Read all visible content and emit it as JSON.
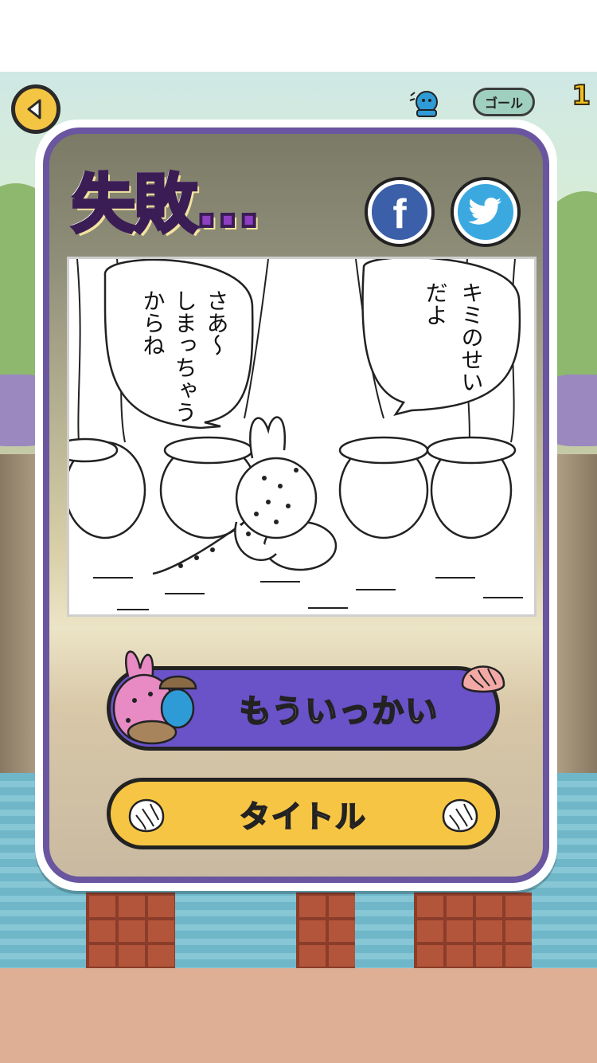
{
  "hud": {
    "goal_label": "ゴール",
    "score": "1"
  },
  "result": {
    "title": "失敗…",
    "share_facebook": "f"
  },
  "comic": {
    "bubble_left": [
      "さあ〜",
      "しまっちゃう",
      "からね"
    ],
    "bubble_right": [
      "キミのせい",
      "だよ"
    ]
  },
  "buttons": {
    "retry_label": "もういっかい",
    "title_label": "タイトル"
  },
  "colors": {
    "panel_border": "#6a55a0",
    "retry_button": "#6a52c8",
    "title_button": "#f6c544",
    "facebook": "#3b5fa8",
    "twitter": "#3ba9e0",
    "ground": "#deaf95"
  }
}
